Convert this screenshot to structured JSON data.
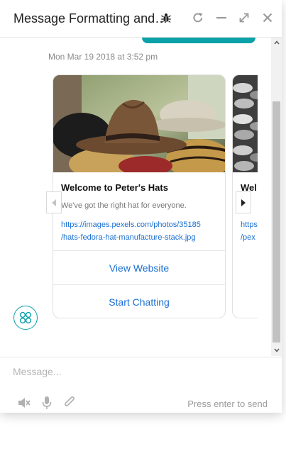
{
  "header": {
    "title": "Message Formatting and…"
  },
  "chat": {
    "timestamp": "Mon Mar 19 2018 at 3:52 pm"
  },
  "cards": [
    {
      "title": "Welcome to Peter's Hats",
      "subtitle": "We've got the right hat for everyone.",
      "link_line1": "https://images.pexels.com/photos/35185",
      "link_line2": "/hats-fedora-hat-manufacture-stack.jpg",
      "button1": "View Website",
      "button2": "Start Chatting"
    },
    {
      "title": "Wel",
      "subtitle": "W",
      "link_line1": "https:",
      "link_line2": "/pex"
    }
  ],
  "composer": {
    "placeholder": "Message...",
    "hint": "Press enter to send"
  },
  "colors": {
    "accent": "#0aa1a8",
    "link": "#1a6fd1"
  },
  "icons": [
    "bug-icon",
    "refresh-icon",
    "minimize-icon",
    "expand-icon",
    "close-icon",
    "chevron-left-icon",
    "chevron-right-icon",
    "apps-icon",
    "mute-icon",
    "microphone-icon",
    "paperclip-icon"
  ]
}
